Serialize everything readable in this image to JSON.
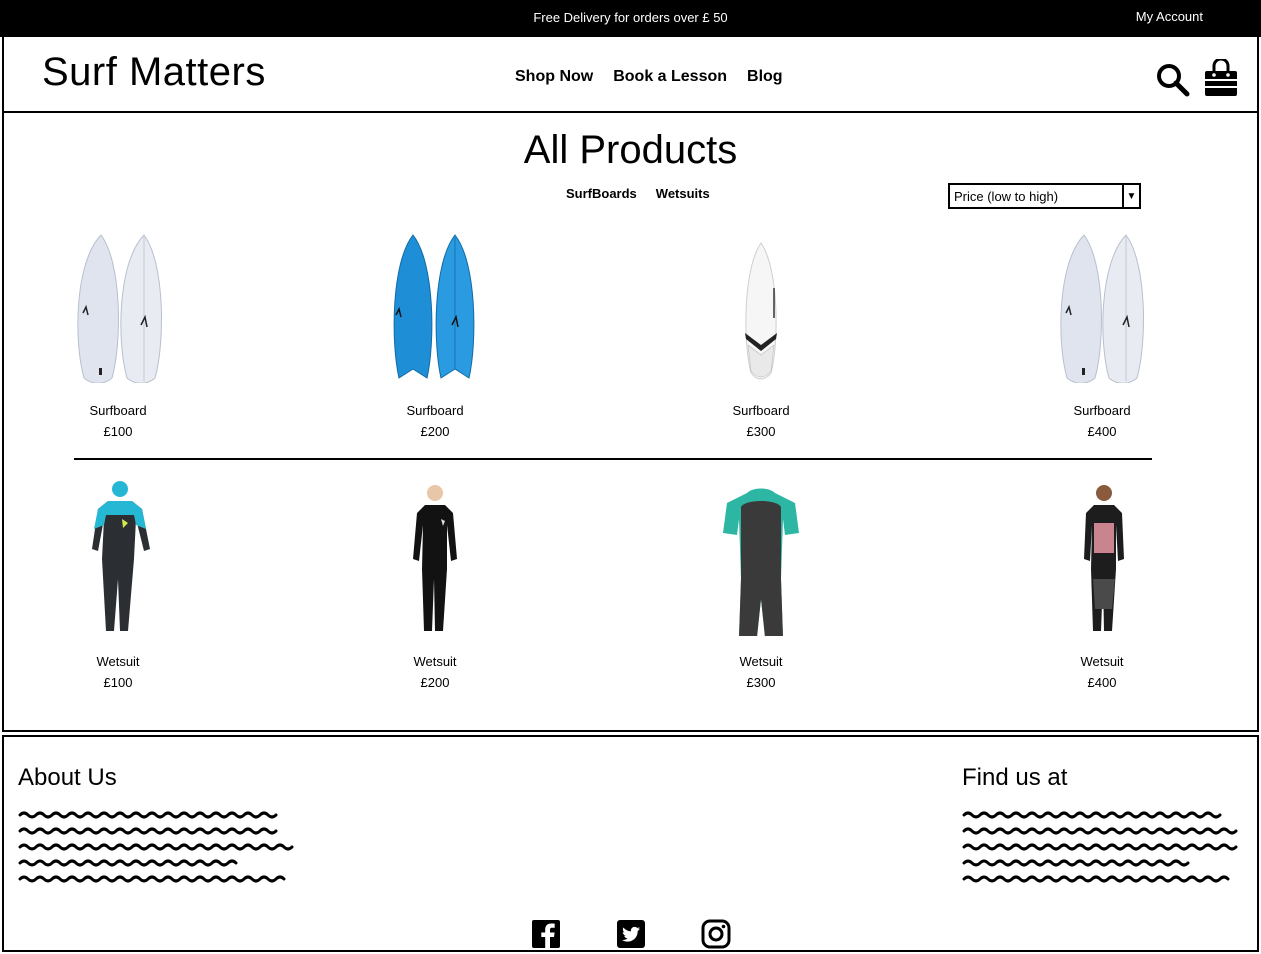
{
  "topbar": {
    "promo": "Free Delivery for orders over £ 50",
    "account": "My Account"
  },
  "header": {
    "logo": "Surf Matters",
    "nav": [
      "Shop Now",
      "Book a Lesson",
      "Blog"
    ],
    "search_icon": "search-icon",
    "cart_icon": "shopping-bag-icon"
  },
  "main": {
    "title": "All Products",
    "filters": [
      "SurfBoards",
      "Wetsuits"
    ],
    "sort": {
      "selected": "Price (low to high)"
    },
    "products": [
      {
        "name": "Surfboard",
        "price": "£100"
      },
      {
        "name": "Surfboard",
        "price": "£200"
      },
      {
        "name": "Surfboard",
        "price": "£300"
      },
      {
        "name": "Surfboard",
        "price": "£400"
      },
      {
        "name": "Wetsuit",
        "price": "£100"
      },
      {
        "name": "Wetsuit",
        "price": "£200"
      },
      {
        "name": "Wetsuit",
        "price": "£300"
      },
      {
        "name": "Wetsuit",
        "price": "£400"
      }
    ]
  },
  "footer": {
    "about_title": "About Us",
    "find_title": "Find us at",
    "social": [
      "facebook-icon",
      "twitter-icon",
      "instagram-icon"
    ]
  },
  "colors": {
    "board_light": "#dfe4ee",
    "board_blue": "#1e8fd6",
    "wetsuit_teal": "#2db6a3",
    "wetsuit_cyan": "#25b7d3"
  }
}
